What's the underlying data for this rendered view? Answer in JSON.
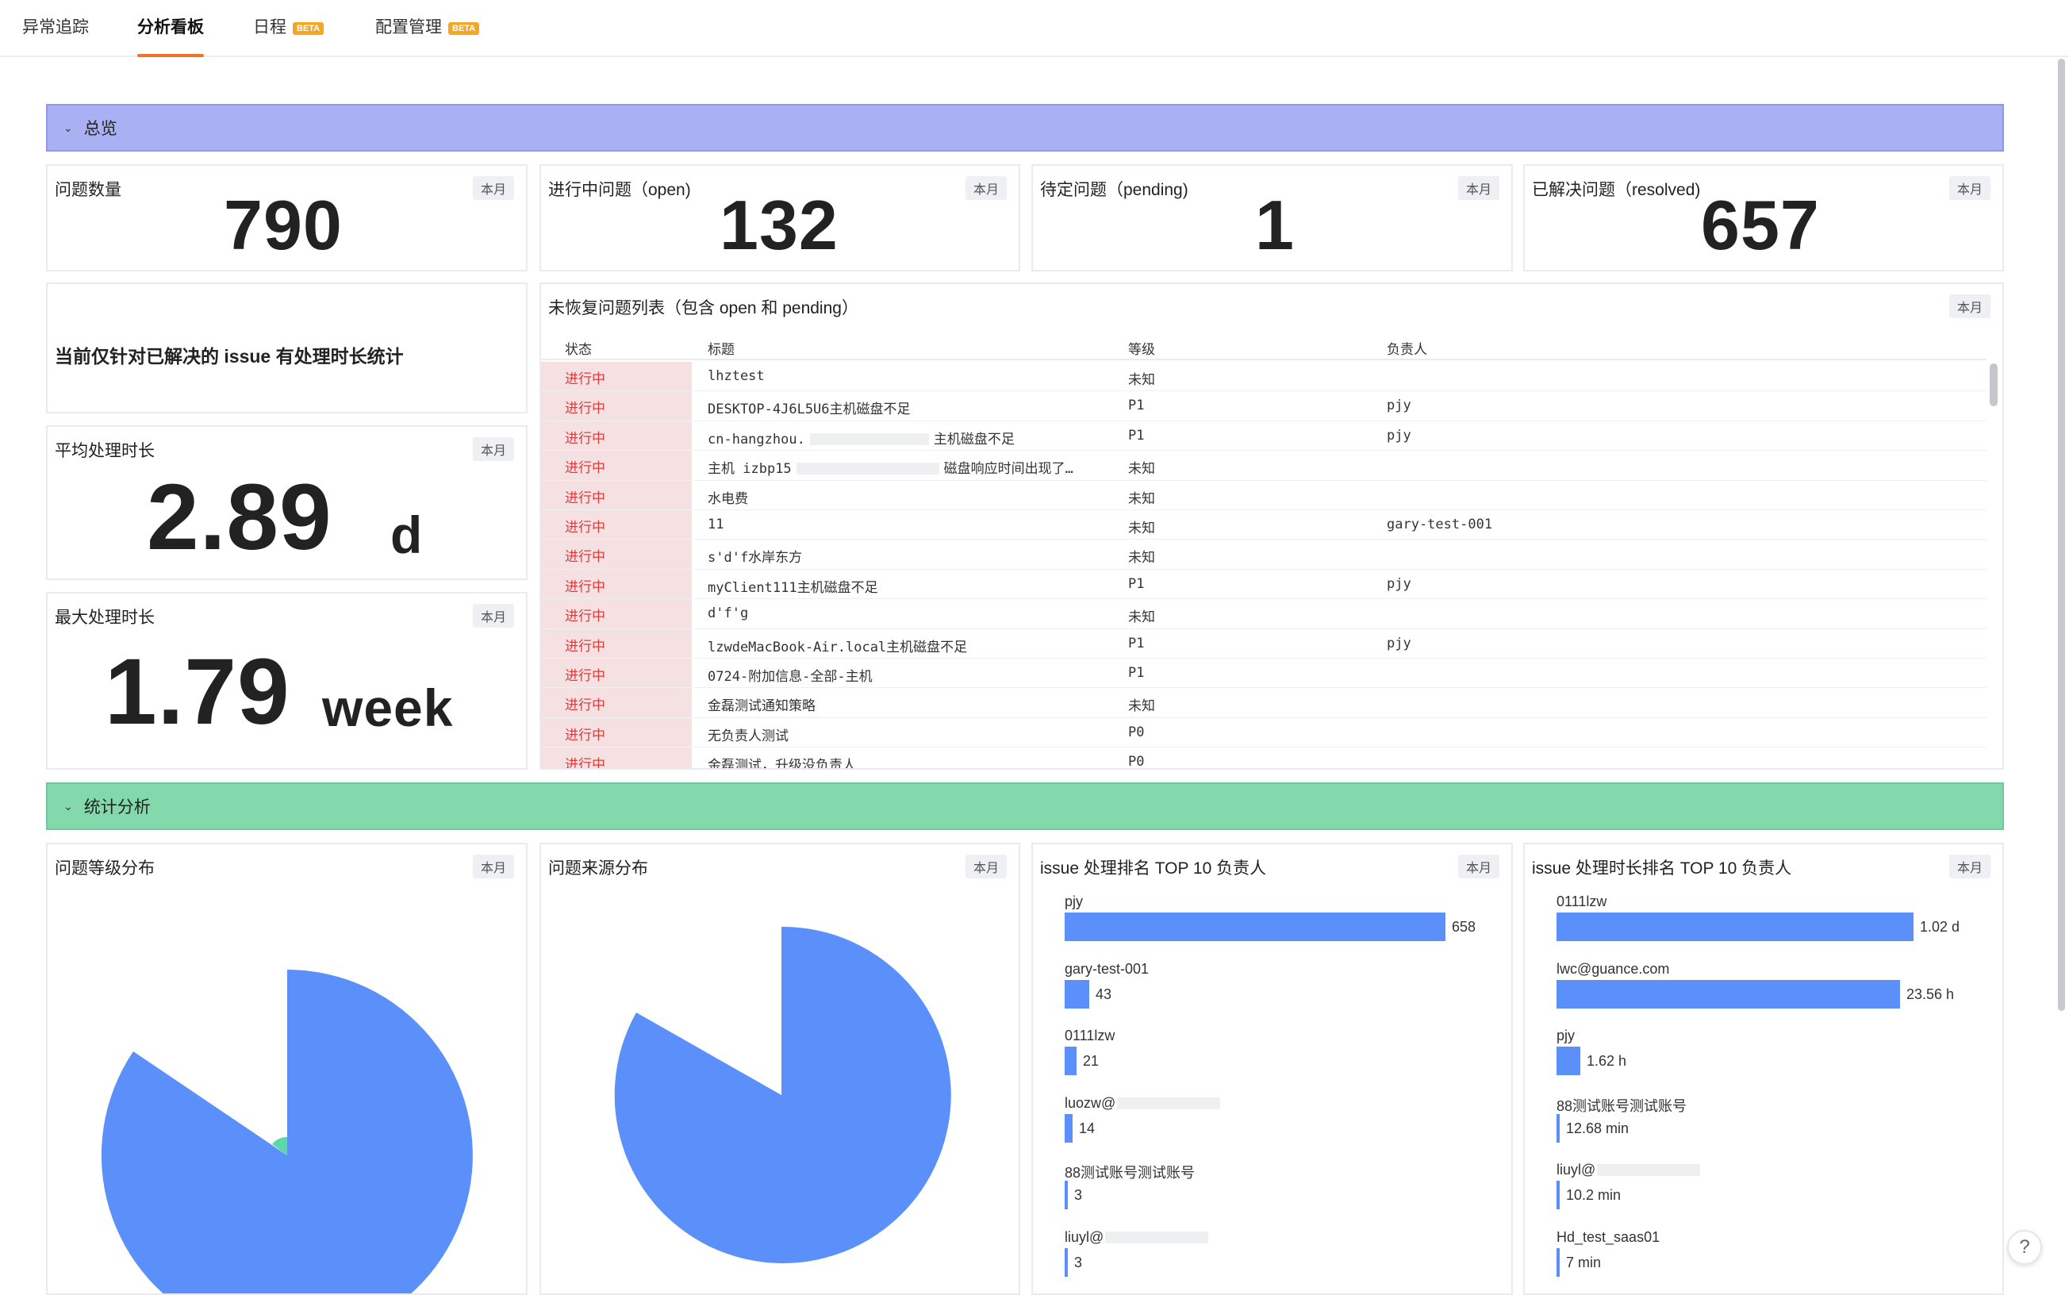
{
  "tabs": [
    {
      "label": "异常追踪",
      "active": false,
      "beta": ""
    },
    {
      "label": "分析看板",
      "active": true,
      "beta": ""
    },
    {
      "label": "日程",
      "active": false,
      "beta": "BETA"
    },
    {
      "label": "配置管理",
      "active": false,
      "beta": "BETA"
    }
  ],
  "sections": {
    "overview": {
      "label": "总览",
      "color": "#a9b1f3"
    },
    "stats": {
      "label": "统计分析",
      "color": "#83d8ac"
    }
  },
  "period_badge": "本月",
  "kpis": {
    "total": {
      "label": "问题数量",
      "value": "790"
    },
    "open": {
      "label": "进行中问题（open)",
      "value": "132"
    },
    "pending": {
      "label": "待定问题（pending)",
      "value": "1"
    },
    "resolved": {
      "label": "已解决问题（resolved)",
      "value": "657"
    }
  },
  "note": "当前仅针对已解决的 issue 有处理时长统计",
  "avg_duration": {
    "label": "平均处理时长",
    "value": "2.89",
    "unit": "d"
  },
  "max_duration": {
    "label": "最大处理时长",
    "value": "1.79",
    "unit": "week"
  },
  "unresolved_table": {
    "title": "未恢复问题列表（包含 open 和 pending）",
    "columns": [
      "状态",
      "标题",
      "等级",
      "负责人"
    ],
    "rows": [
      {
        "status": "进行中",
        "title": "lhztest",
        "level": "未知",
        "owner": ""
      },
      {
        "status": "进行中",
        "title": "DESKTOP-4J6L5U6主机磁盘不足",
        "level": "P1",
        "owner": "pjy"
      },
      {
        "status": "进行中",
        "title": "cn-hangzhou.",
        "title_after": "主机磁盘不足",
        "level": "P1",
        "owner": "pjy"
      },
      {
        "status": "进行中",
        "title": "主机 izbp15",
        "title_after": "磁盘响应时间出现了…",
        "level": "未知",
        "owner": ""
      },
      {
        "status": "进行中",
        "title": "水电费",
        "level": "未知",
        "owner": ""
      },
      {
        "status": "进行中",
        "title": "11",
        "level": "未知",
        "owner": "gary-test-001"
      },
      {
        "status": "进行中",
        "title": "s'd'f水岸东方",
        "level": "未知",
        "owner": ""
      },
      {
        "status": "进行中",
        "title": "myClient111主机磁盘不足",
        "level": "P1",
        "owner": "pjy"
      },
      {
        "status": "进行中",
        "title": "d'f'g",
        "level": "未知",
        "owner": ""
      },
      {
        "status": "进行中",
        "title": "lzwdeMacBook-Air.local主机磁盘不足",
        "level": "P1",
        "owner": "pjy"
      },
      {
        "status": "进行中",
        "title": "0724-附加信息-全部-主机",
        "level": "P1",
        "owner": ""
      },
      {
        "status": "进行中",
        "title": "金磊测试通知策略",
        "level": "未知",
        "owner": ""
      },
      {
        "status": "进行中",
        "title": "无负责人测试",
        "level": "P0",
        "owner": ""
      },
      {
        "status": "进行中",
        "title": "金磊测试，升级没负责人",
        "level": "P0",
        "owner": ""
      }
    ]
  },
  "level_dist": {
    "title": "问题等级分布"
  },
  "source_dist": {
    "title": "问题来源分布"
  },
  "top_count": {
    "title": "issue 处理排名 TOP 10 负责人",
    "items": [
      {
        "name": "pjy",
        "value": 658,
        "label": "658",
        "masked": false
      },
      {
        "name": "gary-test-001",
        "value": 43,
        "label": "43",
        "masked": false
      },
      {
        "name": "0111lzw",
        "value": 21,
        "label": "21",
        "masked": false
      },
      {
        "name": "luozw@",
        "value": 14,
        "label": "14",
        "masked": true
      },
      {
        "name": "88测试账号测试账号",
        "value": 3,
        "label": "3",
        "masked": false
      },
      {
        "name": "liuyl@",
        "value": 3,
        "label": "3",
        "masked": true
      }
    ]
  },
  "top_duration": {
    "title": "issue 处理时长排名 TOP 10 负责人",
    "items": [
      {
        "name": "0111lzw",
        "hours": 24.48,
        "label": "1.02 d",
        "masked": false
      },
      {
        "name": "lwc@guance.com",
        "hours": 23.56,
        "label": "23.56 h",
        "masked": false
      },
      {
        "name": "pjy",
        "hours": 1.62,
        "label": "1.62 h",
        "masked": false
      },
      {
        "name": "88测试账号测试账号",
        "hours": 0.211,
        "label": "12.68 min",
        "masked": false
      },
      {
        "name": "liuyl@",
        "hours": 0.17,
        "label": "10.2 min",
        "masked": true
      },
      {
        "name": "Hd_test_saas01",
        "hours": 0.117,
        "label": "7 min",
        "masked": false
      }
    ]
  },
  "colors": {
    "bar": "#5b8ff9",
    "pie_main": "#5b8ff9",
    "pie_minor": "#5ad8a6",
    "accent": "#f2722b"
  },
  "help": "?"
}
